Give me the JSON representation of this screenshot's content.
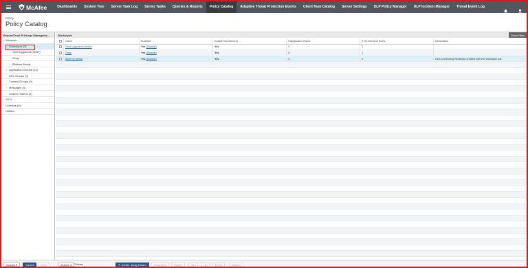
{
  "nav": {
    "brand": "McAfee",
    "items": [
      {
        "label": "Dashboards",
        "active": false
      },
      {
        "label": "System Tree",
        "active": false
      },
      {
        "label": "Server Task Log",
        "active": false
      },
      {
        "label": "Server Tasks",
        "active": false
      },
      {
        "label": "Queries & Reports",
        "active": false
      },
      {
        "label": "Policy Catalog",
        "active": true
      },
      {
        "label": "Adaptive Threat Protection Events",
        "active": false
      },
      {
        "label": "Client Task Catalog",
        "active": false
      },
      {
        "label": "Server Settings",
        "active": false
      },
      {
        "label": "DLP Policy Manager",
        "active": false
      },
      {
        "label": "DLP Incident Manager",
        "active": false
      },
      {
        "label": "Threat Event Log",
        "active": false
      }
    ],
    "icons": [
      "bell-icon",
      "user-icon"
    ]
  },
  "header": {
    "breadcrumb": "Policy",
    "title": "Policy Catalog"
  },
  "tree": {
    "header": "BeyondTrust Privilege Manageme...",
    "items": [
      {
        "label": "Windows",
        "indent": 0,
        "arrow": "⌄"
      },
      {
        "label": "Workstyles (3)",
        "indent": 1,
        "arrow": "⌄",
        "selected": true
      },
      {
        "label": "Sonil Uyguleme Seller)",
        "indent": 2,
        "arrow": "›"
      },
      {
        "label": "Onay",
        "indent": 2,
        "arrow": "›"
      },
      {
        "label": "Bildirme Mesaj",
        "indent": 2,
        "arrow": "›"
      },
      {
        "label": "Application Groups (12)",
        "indent": 1,
        "arrow": "›"
      },
      {
        "label": "URL Groups (0)",
        "indent": 1,
        "arrow": ""
      },
      {
        "label": "Content Groups (0)",
        "indent": 1,
        "arrow": ""
      },
      {
        "label": "Messages (4)",
        "indent": 1,
        "arrow": "›"
      },
      {
        "label": "Custom Tokens (0)",
        "indent": 1,
        "arrow": ""
      },
      {
        "label": "OS X",
        "indent": 0,
        "arrow": "›"
      },
      {
        "label": "Licenses (0)",
        "indent": 0,
        "arrow": ""
      },
      {
        "label": "Utilities",
        "indent": 0,
        "arrow": "›"
      }
    ]
  },
  "panel": {
    "title": "Workstyles",
    "show_filter": "Show Filter",
    "columns": [
      "Name",
      "Enabled",
      "Enable On-Demand",
      "▾ Application Rules",
      "▾ On-Demand Rules",
      "Description"
    ],
    "rows": [
      {
        "name": "Sonil Uyguleme Seller)",
        "enabled": "Yes",
        "enabled_link": "(Disable)",
        "on_demand": "Yes",
        "app_rules": "3",
        "od_rules": "1",
        "description": ""
      },
      {
        "name": "Onay",
        "enabled": "Yes",
        "enabled_link": "(Disable)",
        "on_demand": "Yes",
        "app_rules": "5",
        "od_rules": "1",
        "description": ""
      },
      {
        "name": "Bildirme Mesaj",
        "enabled": "Yes",
        "enabled_link": "(Disable)",
        "on_demand": "Yes",
        "app_rules": "4",
        "od_rules": "1",
        "description": "New Controlling Workstyle created with the Workstyle wiz"
      }
    ]
  },
  "footer_left": {
    "dropdown": "Actions",
    "cancel": "Cancel",
    "save": "Save"
  },
  "footer_main": {
    "actions": "Actions",
    "count": "3 Items",
    "wizard": "Create using Wizard",
    "buttons": [
      "Properties",
      "Delete",
      "Top",
      "Up",
      "Down",
      "Bottom"
    ]
  }
}
